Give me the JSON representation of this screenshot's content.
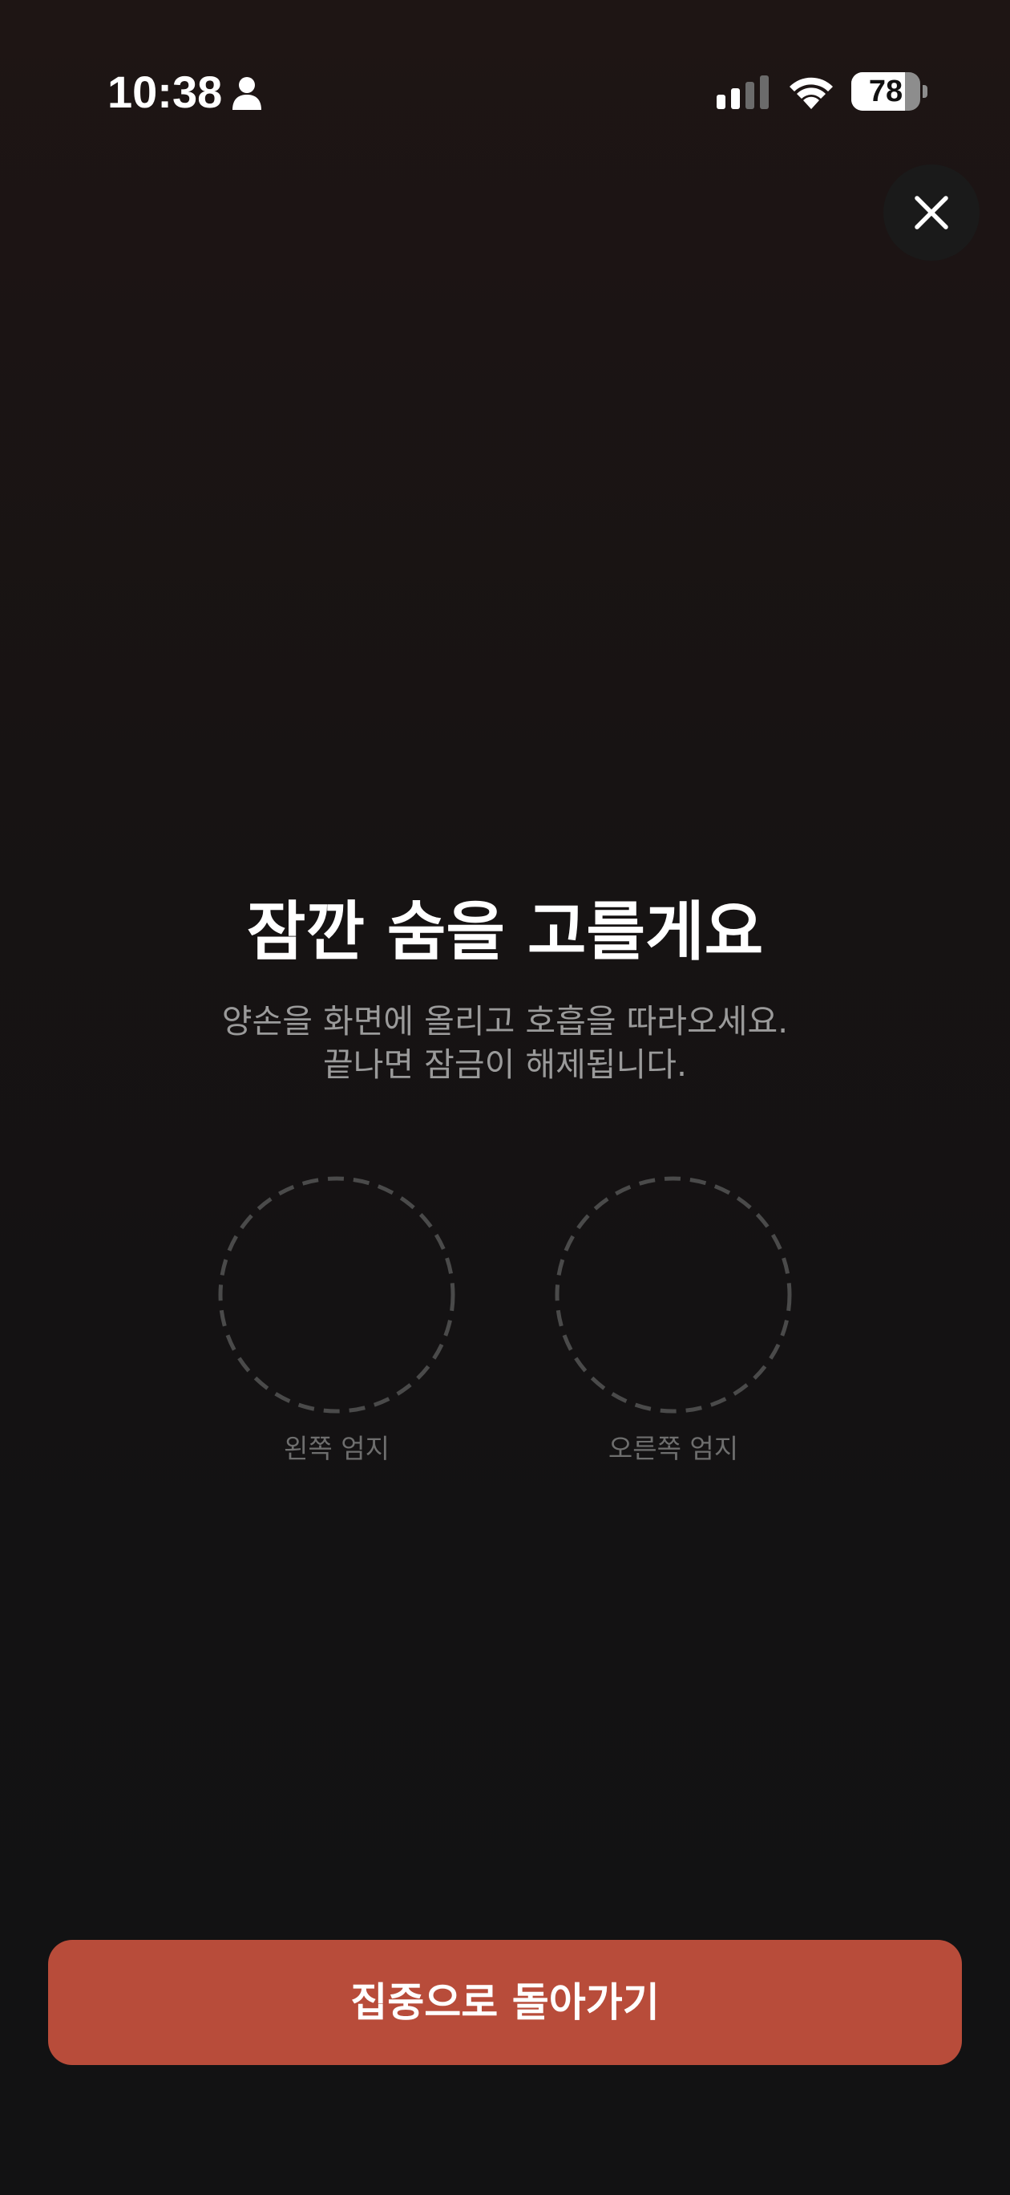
{
  "status_bar": {
    "time": "10:38",
    "battery_level": "78",
    "battery_fraction": 0.78,
    "icons": [
      "person-icon",
      "cellular-signal-icon",
      "wifi-icon",
      "battery-icon"
    ]
  },
  "close_button": {
    "icon": "close-icon"
  },
  "main": {
    "title": "잠깐 숨을 고를게요",
    "subtitle_line1": "양손을 화면에 올리고 호흡을 따라오세요.",
    "subtitle_line2": "끝나면 잠금이 해제됩니다.",
    "thumbs": [
      {
        "label": "왼쪽 엄지"
      },
      {
        "label": "오른쪽 엄지"
      }
    ]
  },
  "footer": {
    "return_button_label": "집중으로 돌아가기"
  },
  "colors": {
    "background_top": "#1e1514",
    "background_bottom": "#121213",
    "accent": "#b84c3a",
    "subtitle_text": "#9a9a9a",
    "thumb_outline": "#4a4a4a"
  }
}
